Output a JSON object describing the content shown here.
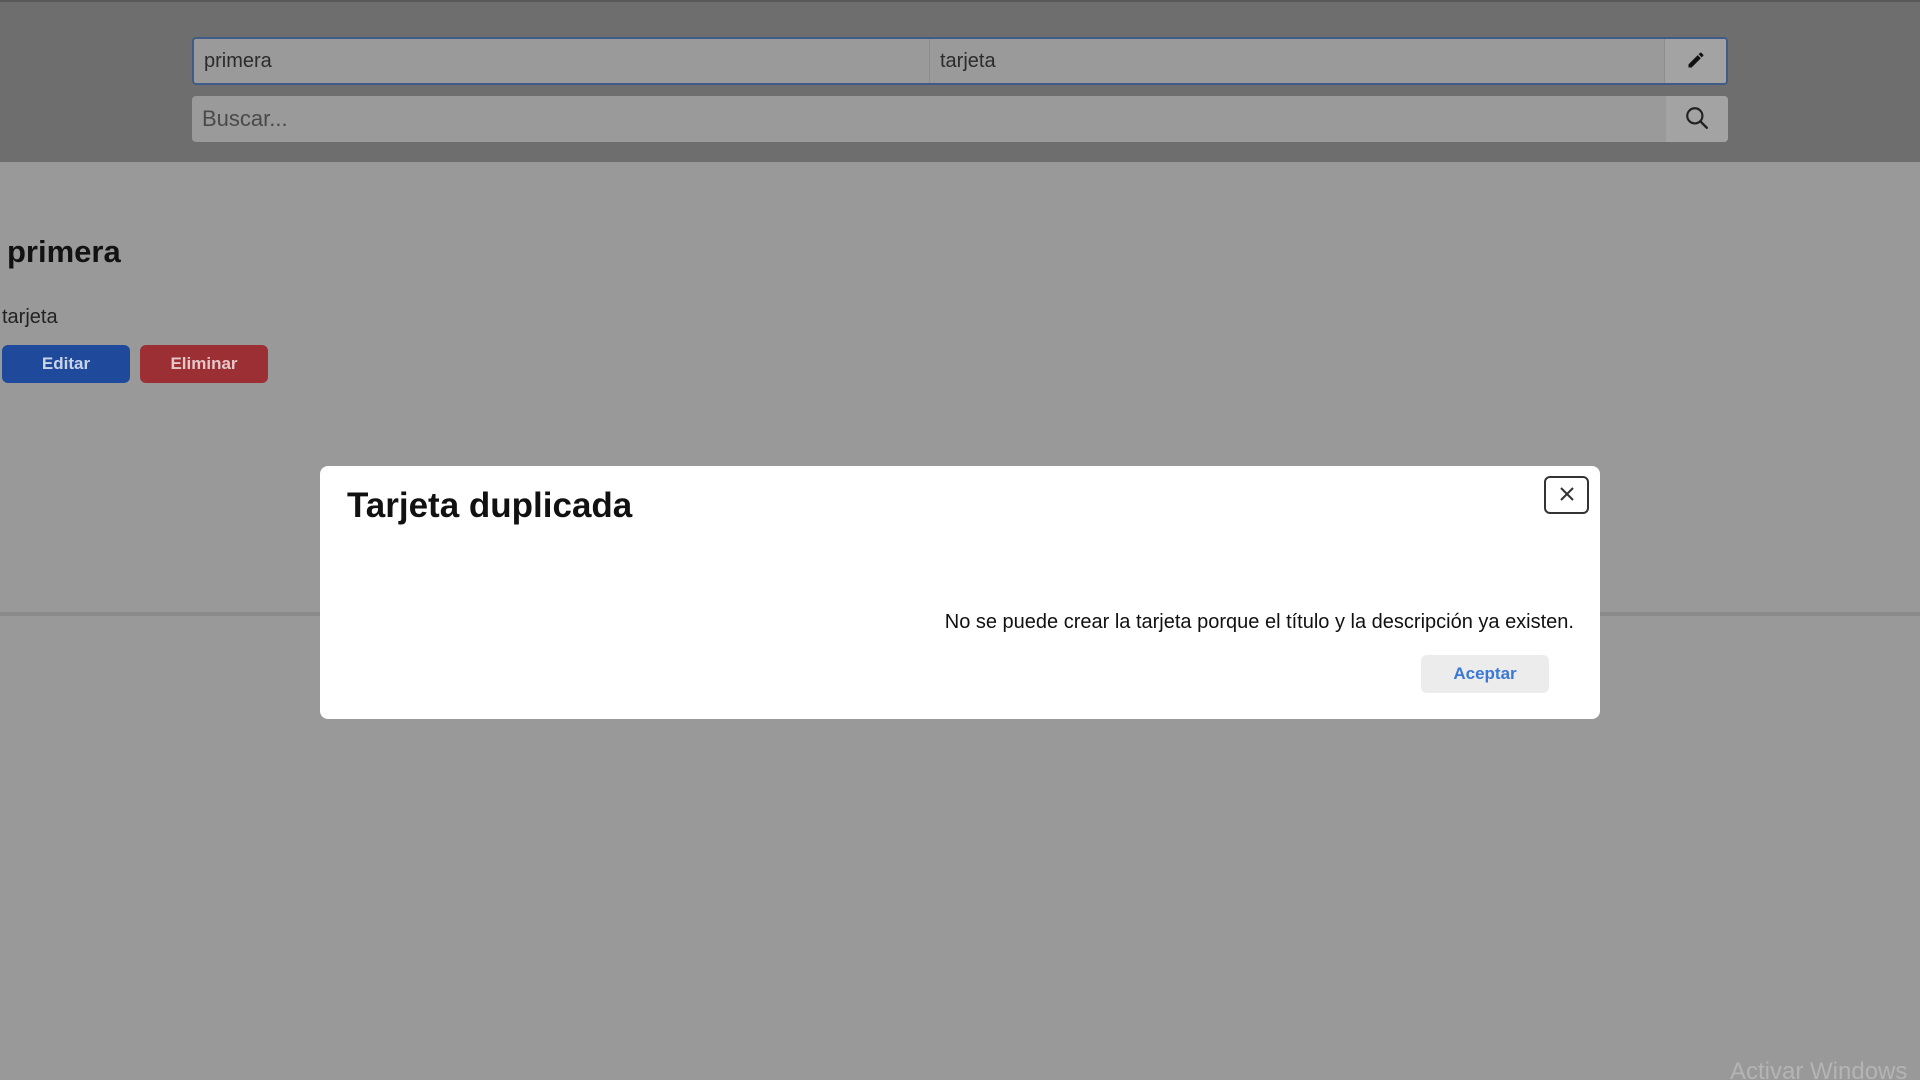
{
  "entry": {
    "title_value": "primera",
    "description_value": "tarjeta",
    "edit_icon": "pencil-icon"
  },
  "search": {
    "placeholder": "Buscar...",
    "icon": "search-icon"
  },
  "card": {
    "title": "primera",
    "description": "tarjeta",
    "edit_label": "Editar",
    "delete_label": "Eliminar"
  },
  "modal": {
    "title": "Tarjeta duplicada",
    "message": "No se puede crear la tarjeta porque el título y la descripción ya existen.",
    "ok_label": "Aceptar",
    "close_icon": "close-icon"
  },
  "watermark": "Activar Windows",
  "colors": {
    "backdrop": "#999999",
    "header": "#6e6e6e",
    "edit_button": "#1f4a9b",
    "delete_button": "#9b2f34",
    "accept_text": "#3b78d6"
  }
}
